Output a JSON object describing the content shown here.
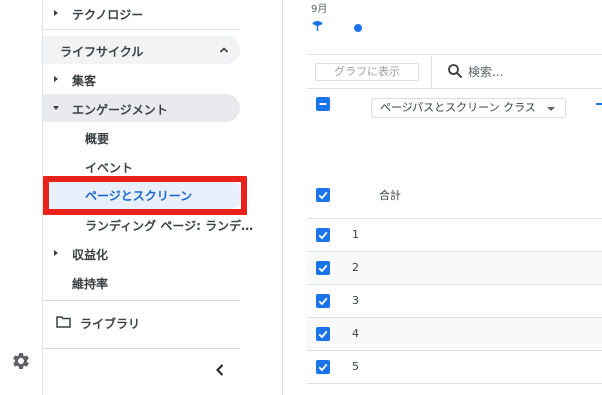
{
  "sidebar": {
    "top_item": "テクノロジー",
    "section_title": "ライフサイクル",
    "items": {
      "acquisition": "集客",
      "engagement": "エンゲージメント",
      "overview": "概要",
      "events": "イベント",
      "pages_screens": "ページとスクリーン",
      "landing": "ランディング ページ: ランデ…",
      "monetization": "収益化",
      "retention": "維持率"
    },
    "library": "ライブラリ"
  },
  "main": {
    "date_label": "9月",
    "legend_color": "#1a73e8",
    "graph_button": "グラフに表示",
    "search_placeholder": "検索...",
    "dimension_select": "ページパスとスクリーン クラス",
    "total_label": "合計",
    "rows": [
      "1",
      "2",
      "3",
      "4",
      "5"
    ]
  },
  "colors": {
    "accent": "#1a73e8",
    "highlight": "#e8221b",
    "active_bg": "#e8f0fe"
  }
}
